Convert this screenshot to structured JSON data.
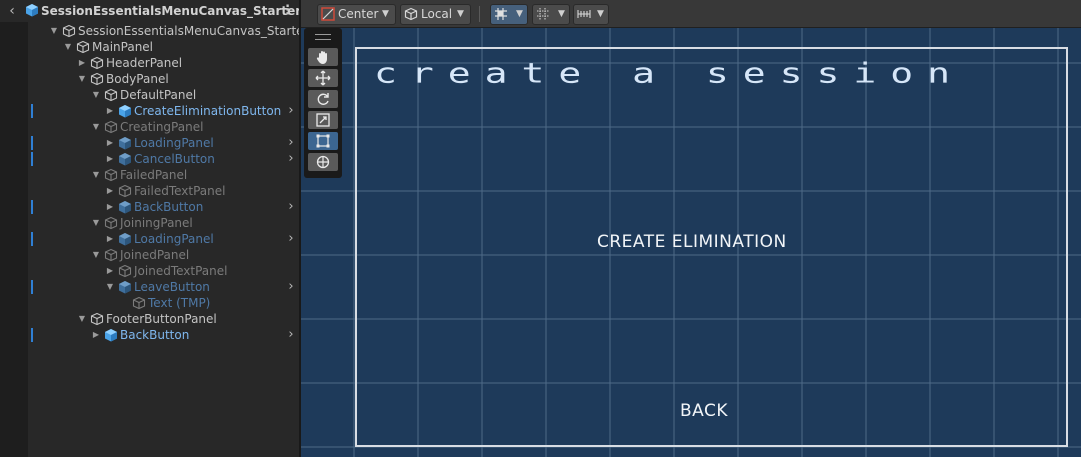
{
  "hierarchy": {
    "title": "SessionEssentialsMenuCanvas_Starter",
    "rows": [
      {
        "label": "SessionEssentialsMenuCanvas_Starter",
        "depth": 0,
        "arrow": "open",
        "icon": "gameobject-icon",
        "style": "normal",
        "mark": false,
        "chevron": false
      },
      {
        "label": "MainPanel",
        "depth": 1,
        "arrow": "open",
        "icon": "gameobject-icon",
        "style": "normal",
        "mark": false,
        "chevron": false
      },
      {
        "label": "HeaderPanel",
        "depth": 2,
        "arrow": "closed",
        "icon": "gameobject-icon",
        "style": "normal",
        "mark": false,
        "chevron": false
      },
      {
        "label": "BodyPanel",
        "depth": 2,
        "arrow": "open",
        "icon": "gameobject-icon",
        "style": "normal",
        "mark": false,
        "chevron": false
      },
      {
        "label": "DefaultPanel",
        "depth": 3,
        "arrow": "open",
        "icon": "gameobject-icon",
        "style": "normal",
        "mark": false,
        "chevron": false
      },
      {
        "label": "CreateEliminationButton",
        "depth": 4,
        "arrow": "closed",
        "icon": "prefab-icon",
        "style": "prefab",
        "mark": true,
        "chevron": true
      },
      {
        "label": "CreatingPanel",
        "depth": 3,
        "arrow": "open",
        "icon": "gameobject-icon",
        "style": "dim",
        "mark": false,
        "chevron": false
      },
      {
        "label": "LoadingPanel",
        "depth": 4,
        "arrow": "closed",
        "icon": "prefab-icon",
        "style": "prefab-dim",
        "mark": true,
        "chevron": true
      },
      {
        "label": "CancelButton",
        "depth": 4,
        "arrow": "closed",
        "icon": "prefab-icon",
        "style": "prefab-dim",
        "mark": true,
        "chevron": true
      },
      {
        "label": "FailedPanel",
        "depth": 3,
        "arrow": "open",
        "icon": "gameobject-icon",
        "style": "dim",
        "mark": false,
        "chevron": false
      },
      {
        "label": "FailedTextPanel",
        "depth": 4,
        "arrow": "closed",
        "icon": "gameobject-icon",
        "style": "dim",
        "mark": false,
        "chevron": false
      },
      {
        "label": "BackButton",
        "depth": 4,
        "arrow": "closed",
        "icon": "prefab-icon",
        "style": "prefab-dim",
        "mark": true,
        "chevron": true
      },
      {
        "label": "JoiningPanel",
        "depth": 3,
        "arrow": "open",
        "icon": "gameobject-icon",
        "style": "dim",
        "mark": false,
        "chevron": false
      },
      {
        "label": "LoadingPanel",
        "depth": 4,
        "arrow": "closed",
        "icon": "prefab-icon",
        "style": "prefab-dim",
        "mark": true,
        "chevron": true
      },
      {
        "label": "JoinedPanel",
        "depth": 3,
        "arrow": "open",
        "icon": "gameobject-icon",
        "style": "dim",
        "mark": false,
        "chevron": false
      },
      {
        "label": "JoinedTextPanel",
        "depth": 4,
        "arrow": "closed",
        "icon": "gameobject-icon",
        "style": "dim",
        "mark": false,
        "chevron": false
      },
      {
        "label": "LeaveButton",
        "depth": 4,
        "arrow": "open",
        "icon": "prefab-icon",
        "style": "prefab-dim",
        "mark": true,
        "chevron": true
      },
      {
        "label": "Text (TMP)",
        "depth": 5,
        "arrow": "none",
        "icon": "gameobject-icon",
        "style": "prefab-dim",
        "mark": false,
        "chevron": false
      },
      {
        "label": "FooterButtonPanel",
        "depth": 2,
        "arrow": "open",
        "icon": "gameobject-icon",
        "style": "normal",
        "mark": false,
        "chevron": false
      },
      {
        "label": "BackButton",
        "depth": 3,
        "arrow": "closed",
        "icon": "prefab-icon",
        "style": "prefab",
        "mark": true,
        "chevron": true
      }
    ]
  },
  "scene_toolbar": {
    "pivot_label": "Center",
    "space_label": "Local"
  },
  "scene": {
    "title_text": "create a session",
    "create_text": "CREATE ELIMINATION",
    "back_text": "BACK"
  },
  "colors": {
    "scene_bg": "#1e3a5a",
    "prefab_text": "#7fb7ee",
    "selection_mark": "#2f7fd4"
  }
}
